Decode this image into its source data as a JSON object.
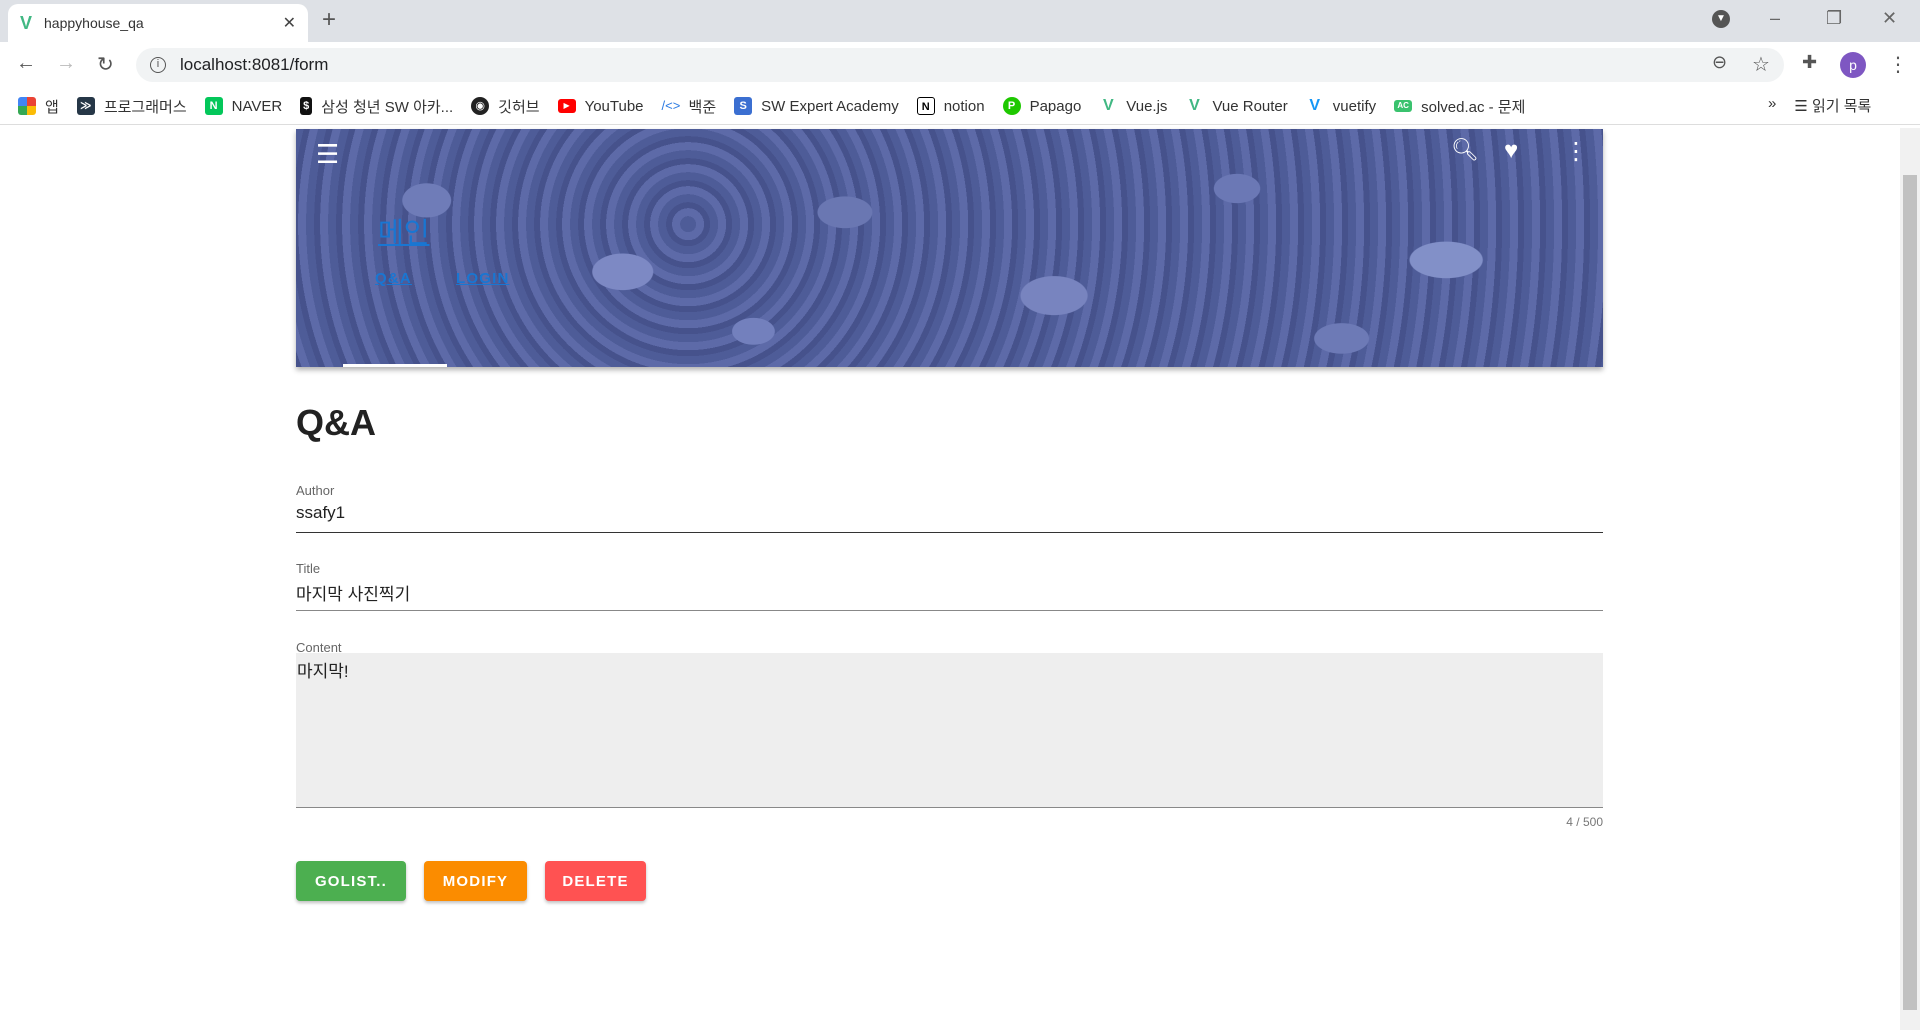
{
  "browser": {
    "tab_title": "happyhouse_qa",
    "url": "localhost:8081/form",
    "profile_initial": "p",
    "bookmarks": [
      "앱",
      "프로그래머스",
      "NAVER",
      "삼성 청년 SW 아카...",
      "깃허브",
      "YouTube",
      "백준",
      "SW Expert Academy",
      "notion",
      "Papago",
      "Vue.js",
      "Vue Router",
      "vuetify",
      "solved.ac - 문제"
    ],
    "more": "»",
    "reading_list": "읽기 목록"
  },
  "appbar": {
    "title": "메인",
    "tabs": [
      "Q&A",
      "LOGIN"
    ],
    "active_tab": "Q&A"
  },
  "page": {
    "heading": "Q&A",
    "fields": {
      "author": {
        "label": "Author",
        "value": "ssafy1"
      },
      "title": {
        "label": "Title",
        "value": "마지막 사진찍기"
      },
      "content": {
        "label": "Content",
        "value": "마지막!",
        "counter": "4 / 500"
      }
    },
    "buttons": {
      "golist": "GOLIST..",
      "modify": "MODIFY",
      "delete": "DELETE"
    }
  },
  "colors": {
    "golist": "#4caf50",
    "modify": "#fb8c00",
    "delete": "#ff5252",
    "link": "#1976d2"
  }
}
